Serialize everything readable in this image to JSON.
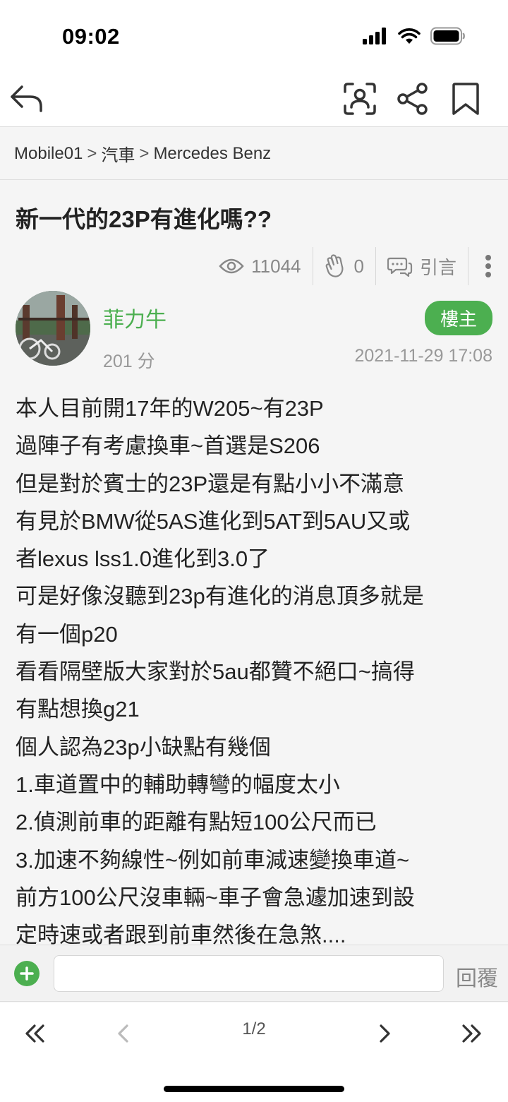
{
  "status_bar": {
    "time": "09:02",
    "icons": [
      "cellular-signal-icon",
      "wifi-icon",
      "battery-icon"
    ]
  },
  "nav_bar": {
    "icons": [
      "reply-arrow-icon",
      "scan-user-icon",
      "share-icon",
      "bookmark-icon"
    ]
  },
  "breadcrumb": {
    "items": [
      "Mobile01",
      "汽車",
      "Mercedes Benz"
    ],
    "separator": ">"
  },
  "post": {
    "title": "新一代的23P有進化嗎??",
    "stats": {
      "views": "11044",
      "claps": "0",
      "quote_label": "引言"
    },
    "author": {
      "name": "菲力牛",
      "score": "201 分",
      "badge": "樓主",
      "timestamp": "2021-11-29 17:08"
    },
    "body_lines": [
      "本人目前開17年的W205~有23P",
      "過陣子有考慮換車~首選是S206",
      "但是對於賓士的23P還是有點小小不滿意",
      "有見於BMW從5AS進化到5AT到5AU又或",
      "者lexus lss1.0進化到3.0了",
      "可是好像沒聽到23p有進化的消息頂多就是",
      "有一個p20",
      "看看隔壁版大家對於5au都贊不絕口~搞得",
      "有點想換g21",
      "個人認為23p小缺點有幾個",
      "1.車道置中的輔助轉彎的幅度太小",
      "2.偵測前車的距離有點短100公尺而已",
      "3.加速不夠線性~例如前車減速變換車道~",
      "前方100公尺沒車輛~車子會急遽加速到設",
      "定時速或者跟到前車然後在急煞...."
    ]
  },
  "reply_bar": {
    "add_icon": "plus-icon",
    "input_value": "",
    "reply_label": "回覆"
  },
  "pager": {
    "indicator": "1/2",
    "icons": [
      "first-page-icon",
      "prev-page-icon",
      "next-page-icon",
      "last-page-icon"
    ]
  },
  "colors": {
    "accent": "#4caf50",
    "muted": "#888888",
    "background": "#f5f5f5"
  }
}
